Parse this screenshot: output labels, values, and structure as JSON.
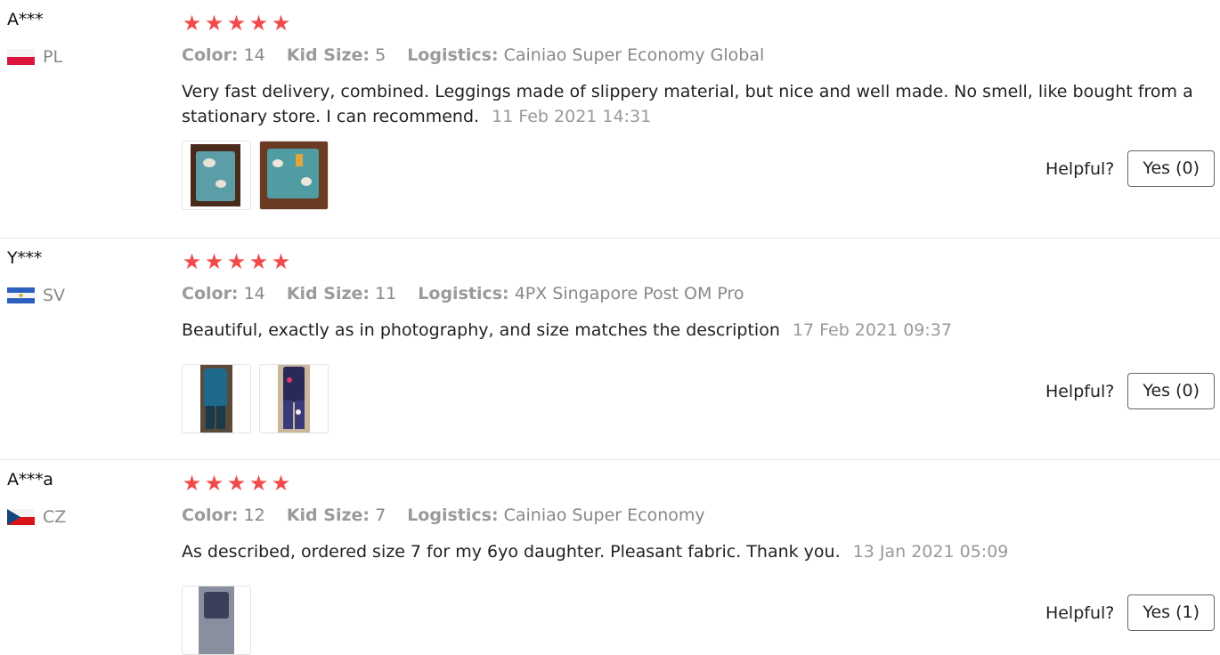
{
  "reviews": [
    {
      "user": "A***",
      "country": "PL",
      "flag": "poland",
      "rating": 5,
      "color_label": "Color:",
      "color": "14",
      "size_label": "Kid Size:",
      "size": "5",
      "logistics_label": "Logistics:",
      "logistics": "Cainiao Super Economy Global",
      "text": "Very fast delivery, combined. Leggings made of slippery material, but nice and well made. No smell, like bought from a stationary store. I can recommend.",
      "date": "11 Feb 2021 14:31",
      "photos": 2,
      "helpful_label": "Helpful?",
      "yes": "Yes (0)"
    },
    {
      "user": "Y***",
      "country": "SV",
      "flag": "el-salvador",
      "rating": 5,
      "color_label": "Color:",
      "color": "14",
      "size_label": "Kid Size:",
      "size": "11",
      "logistics_label": "Logistics:",
      "logistics": "4PX Singapore Post OM Pro",
      "text": "Beautiful, exactly as in photography, and size matches the description",
      "date": "17 Feb 2021 09:37",
      "photos": 2,
      "helpful_label": "Helpful?",
      "yes": "Yes (0)"
    },
    {
      "user": "A***a",
      "country": "CZ",
      "flag": "czech-republic",
      "rating": 5,
      "color_label": "Color:",
      "color": "12",
      "size_label": "Kid Size:",
      "size": "7",
      "logistics_label": "Logistics:",
      "logistics": "Cainiao Super Economy",
      "text": "As described, ordered size 7 for my 6yo daughter. Pleasant fabric. Thank you.",
      "date": "13 Jan 2021 05:09",
      "photos": 1,
      "helpful_label": "Helpful?",
      "yes": "Yes (1)"
    }
  ],
  "colors": {
    "star": "#f24a4a",
    "muted": "#999999",
    "divider": "#e5e5e5"
  }
}
